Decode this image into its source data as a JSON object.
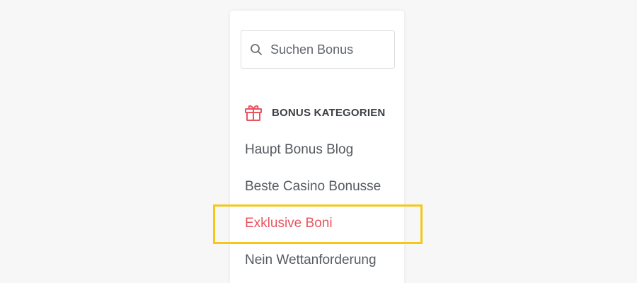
{
  "search": {
    "placeholder": "Suchen Bonus",
    "value": ""
  },
  "categories": {
    "title": "BONUS KATEGORIEN",
    "items": [
      {
        "label": "Haupt Bonus Blog"
      },
      {
        "label": "Beste Casino Bonusse"
      },
      {
        "label": "Exklusive Boni",
        "active": true
      },
      {
        "label": "Nein Wettanforderung"
      }
    ]
  },
  "icons": {
    "search": "search-icon",
    "section": "gift-icon"
  },
  "colors": {
    "background": "#f6f7f6",
    "panel": "#ffffff",
    "text": "#555a5f",
    "heading": "#3b3f44",
    "accent": "#e85460",
    "highlight": "#f5c719",
    "border": "#d9dcdf"
  }
}
